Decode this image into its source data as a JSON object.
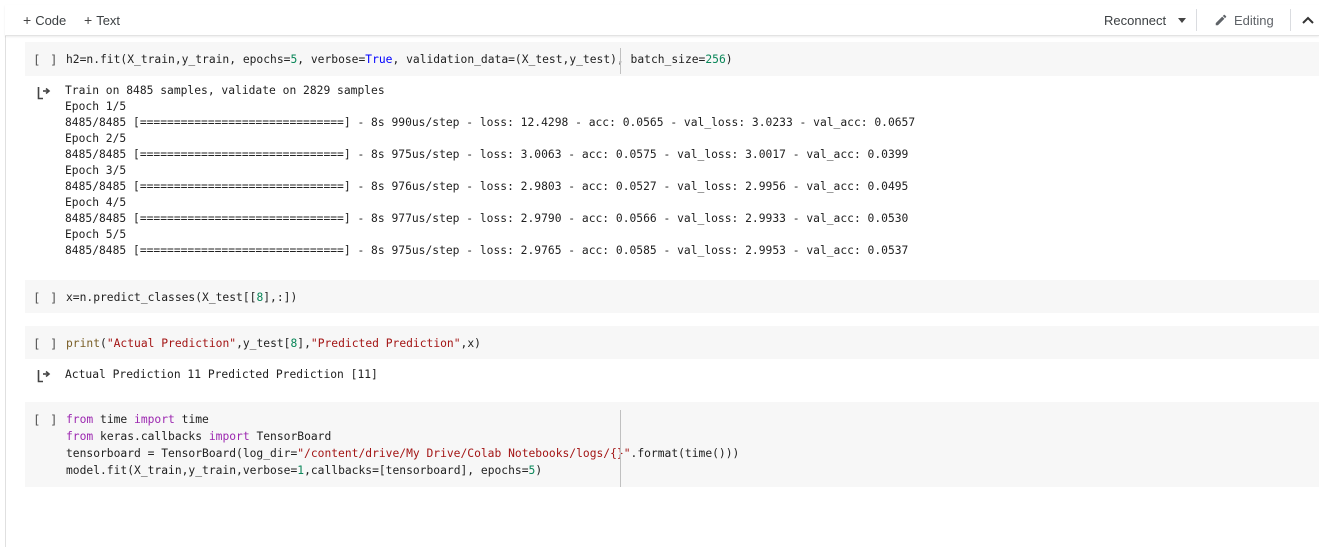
{
  "toolbar": {
    "add_code_label": "Code",
    "add_text_label": "Text",
    "reconnect_label": "Reconnect",
    "editing_label": "Editing"
  },
  "run_button_label": "[ ]",
  "cells": {
    "c1": {
      "p1": "h2=n.fit(X_train,y_train, epochs=",
      "n1": "5",
      "p2": ", verbose=",
      "k1": "True",
      "p3": ", validation_data=(X_test,y_test), batch_size=",
      "n2": "256",
      "p4": ")"
    },
    "c2": {
      "p1": "x=n.predict_classes(X_test[[",
      "n1": "8",
      "p2": "],:])"
    },
    "c3": {
      "fn": "print",
      "p1": "(",
      "s1": "\"Actual Prediction\"",
      "p2": ",y_test[",
      "n1": "8",
      "p3": "],",
      "s2": "\"Predicted Prediction\"",
      "p4": ",x)"
    },
    "c4": {
      "l1_kw1": "from",
      "l1_t1": " time ",
      "l1_kw2": "import",
      "l1_t2": " time",
      "l2_kw1": "from",
      "l2_t1": " keras.callbacks ",
      "l2_kw2": "import",
      "l2_t2": " TensorBoard",
      "l3_t1": "tensorboard = TensorBoard(log_dir=",
      "l3_s1": "\"/content/drive/My Drive/Colab Notebooks/logs/{}\"",
      "l3_t2": ".format(time()))",
      "l4_t1": "model.fit(X_train,y_train,verbose=",
      "l4_n1": "1",
      "l4_t2": ",callbacks=[tensorboard], epochs=",
      "l4_n2": "5",
      "l4_t3": ")"
    }
  },
  "outputs": {
    "o1": [
      "Train on 8485 samples, validate on 2829 samples",
      "Epoch 1/5",
      "8485/8485 [==============================] - 8s 990us/step - loss: 12.4298 - acc: 0.0565 - val_loss: 3.0233 - val_acc: 0.0657",
      "Epoch 2/5",
      "8485/8485 [==============================] - 8s 975us/step - loss: 3.0063 - acc: 0.0575 - val_loss: 3.0017 - val_acc: 0.0399",
      "Epoch 3/5",
      "8485/8485 [==============================] - 8s 976us/step - loss: 2.9803 - acc: 0.0527 - val_loss: 2.9956 - val_acc: 0.0495",
      "Epoch 4/5",
      "8485/8485 [==============================] - 8s 977us/step - loss: 2.9790 - acc: 0.0566 - val_loss: 2.9933 - val_acc: 0.0530",
      "Epoch 5/5",
      "8485/8485 [==============================] - 8s 975us/step - loss: 2.9765 - acc: 0.0585 - val_loss: 2.9953 - val_acc: 0.0537"
    ],
    "o2": "Actual Prediction 11 Predicted Prediction [11]"
  },
  "colors": {
    "keyword": "#9c27b0",
    "string": "#a31515",
    "number": "#098658",
    "constant": "#0000ff",
    "cell_bg": "#f7f7f7"
  },
  "icons": {
    "output": "output-arrow-icon",
    "editing": "pencil-icon",
    "collapse": "chevron-up-icon",
    "reconnect_menu": "caret-down-icon"
  }
}
